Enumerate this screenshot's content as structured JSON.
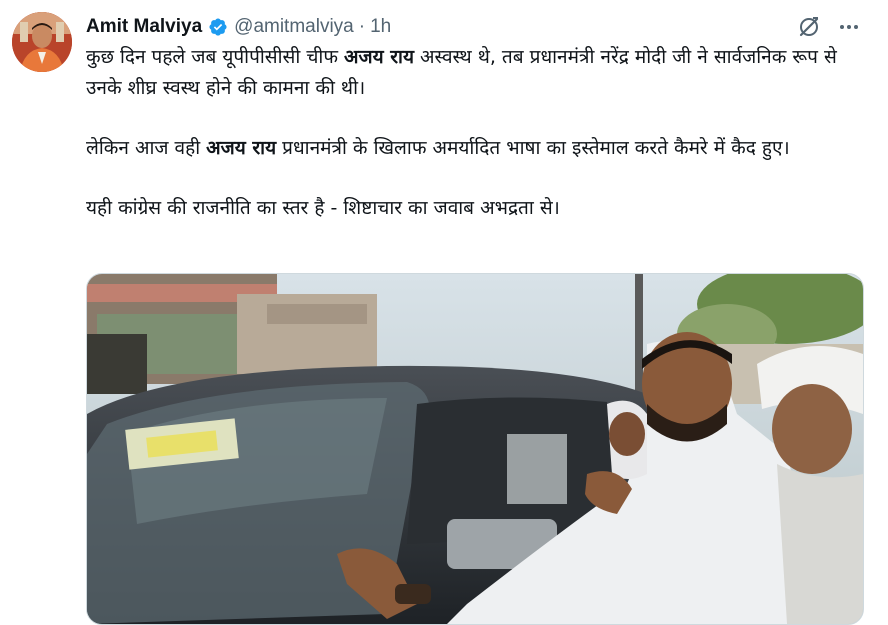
{
  "author": {
    "name": "Amit Malviya",
    "handle": "@amitmalviya",
    "separator": "·",
    "time": "1h",
    "verified": true
  },
  "tweet": {
    "p1_a": "कुछ दिन पहले जब यूपीपीसीसी चीफ ",
    "p1_bold": "अजय राय",
    "p1_b": " अस्वस्थ थे, तब प्रधानमंत्री नरेंद्र मोदी जी ने सार्वजनिक रूप से उनके शीघ्र स्वस्थ होने की कामना की थी।",
    "p2_a": "लेकिन आज वही ",
    "p2_bold": "अजय राय",
    "p2_b": " प्रधानमंत्री के खिलाफ अमर्यादित भाषा का इस्तेमाल करते कैमरे में कैद हुए।",
    "p3": "यही कांग्रेस की राजनीति का स्तर है - शिष्टाचार का जवाब अभद्रता से।"
  },
  "icons": {
    "verified": "verified-badge-icon",
    "grok": "grok-icon",
    "more": "more-icon"
  },
  "colors": {
    "text": "#0f1419",
    "secondary": "#536471",
    "verified": "#1d9bf0",
    "border": "#cfd9de"
  }
}
